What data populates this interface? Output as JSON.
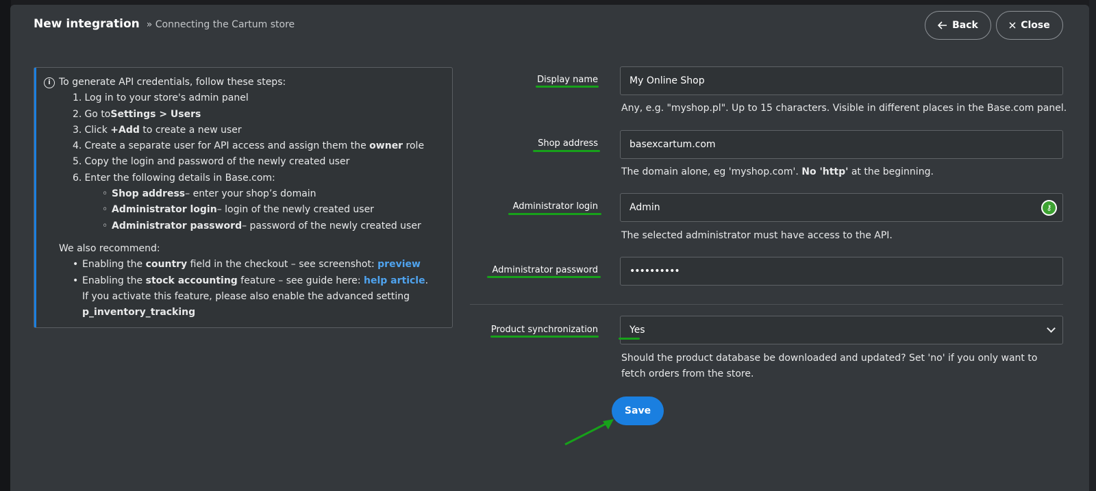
{
  "header": {
    "title": "New integration",
    "subtitle": "» Connecting the Cartum store",
    "back_label": "Back",
    "close_label": "Close"
  },
  "info": {
    "intro": "To generate API credentials, follow these steps:",
    "steps": [
      {
        "num": "1.",
        "parts": [
          "Log in to your store's admin panel"
        ]
      },
      {
        "num": "2.",
        "parts": [
          "Go to ",
          "Settings > Users"
        ]
      },
      {
        "num": "3.",
        "parts": [
          "Click ",
          "+Add",
          " to create a new user"
        ]
      },
      {
        "num": "4.",
        "parts": [
          "Create a separate user for API access and assign them the ",
          "owner",
          " role"
        ]
      },
      {
        "num": "5.",
        "parts": [
          "Copy the login and password of the newly created user"
        ]
      },
      {
        "num": "6.",
        "parts": [
          "Enter the following details in Base.com:"
        ]
      }
    ],
    "details": [
      {
        "bold": "Shop address",
        "text": " – enter your shop’s domain"
      },
      {
        "bold": "Administrator login",
        "text": " – login of the newly created user"
      },
      {
        "bold": "Administrator password",
        "text": " – password of the newly created user"
      }
    ],
    "recommend_title": "We also recommend:",
    "rec1": {
      "a": "Enabling the ",
      "bold": "country",
      "b": " field in the checkout – see screenshot: ",
      "link": "preview"
    },
    "rec2": {
      "a": "Enabling the ",
      "bold": "stock accounting",
      "b": " feature – see guide here: ",
      "link": "help article",
      "c": ". If you activate this feature, please also enable the advanced setting ",
      "code": "p_inventory_tracking"
    }
  },
  "form": {
    "display_name": {
      "label": "Display name",
      "value": "My Online Shop",
      "hint": "Any, e.g. \"myshop.pl\". Up to 15 characters. Visible in different places in the Base.com panel."
    },
    "shop_address": {
      "label": "Shop address",
      "value": "basexcartum.com",
      "hint_a": "The domain alone, eg 'myshop.com'. ",
      "hint_bold": "No 'http'",
      "hint_b": " at the beginning."
    },
    "admin_login": {
      "label": "Administrator login",
      "value": "Admin",
      "hint": "The selected administrator must have access to the API."
    },
    "admin_password": {
      "label": "Administrator password",
      "value": "••••••••••"
    },
    "product_sync": {
      "label": "Product synchronization",
      "value": "Yes",
      "hint": "Should the product database be downloaded and updated? Set 'no' if you only want to fetch orders from the store."
    },
    "save_label": "Save"
  },
  "colors": {
    "accent": "#1a7fe0",
    "highlight": "#17a11a",
    "panel": "#34383c"
  }
}
